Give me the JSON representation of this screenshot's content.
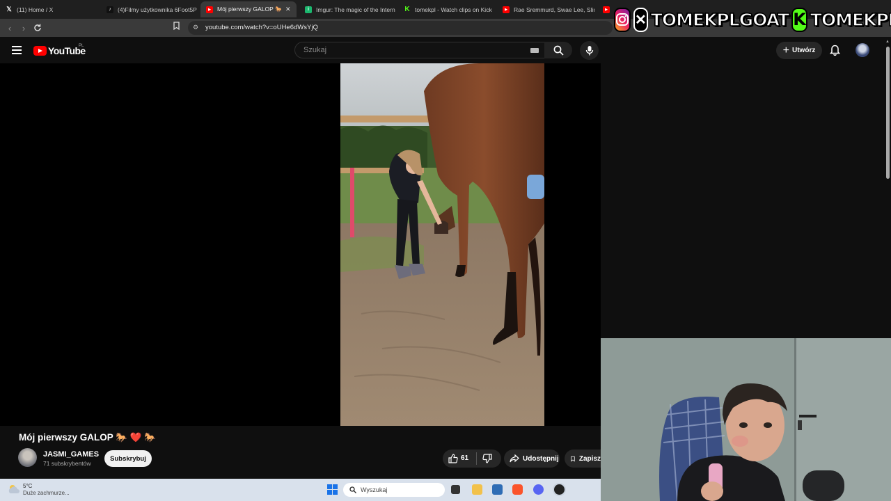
{
  "browser": {
    "tabs": [
      {
        "title": "(11) Home / X",
        "icon": "x-logo-icon",
        "active": false
      },
      {
        "title": "(4)Filmy użytkownika 6Foot5P",
        "icon": "tiktok-icon",
        "active": false
      },
      {
        "title": "Mój pierwszy GALOP 🐎 ❤️",
        "icon": "youtube-icon",
        "active": true
      },
      {
        "title": "Imgur: The magic of the Intern",
        "icon": "imgur-icon",
        "active": false
      },
      {
        "title": "tomekpl - Watch clips on Kick",
        "icon": "kick-icon",
        "active": false
      },
      {
        "title": "Rae Sremmurd, Swae Lee, Slim",
        "icon": "youtube-icon",
        "active": false
      }
    ],
    "url": "youtube.com/watch?v=oUHe6dWsYjQ"
  },
  "overlay": {
    "handle_instagram_x": "TOMEKPLGOAT",
    "kick_letter": "K",
    "handle_kick": "TOMEKPL"
  },
  "youtube": {
    "logo_text": "YouTube",
    "region": "PL",
    "search_placeholder": "Szukaj",
    "create_label": "Utwórz"
  },
  "video": {
    "title": "Mój pierwszy GALOP 🐎 ❤️ 🐎",
    "channel": "JASMI_GAMES",
    "subscribers": "71 subskrybentów",
    "subscribe_label": "Subskrybuj",
    "likes": "61",
    "share_label": "Udostępnij",
    "save_label": "Zapisz"
  },
  "taskbar": {
    "temperature": "5°C",
    "weather": "Duże zachmurze...",
    "search_label": "Wyszukaj"
  },
  "colors": {
    "youtube_red": "#ff0000",
    "kick_green": "#53fc18",
    "background": "#0f0f0f"
  }
}
